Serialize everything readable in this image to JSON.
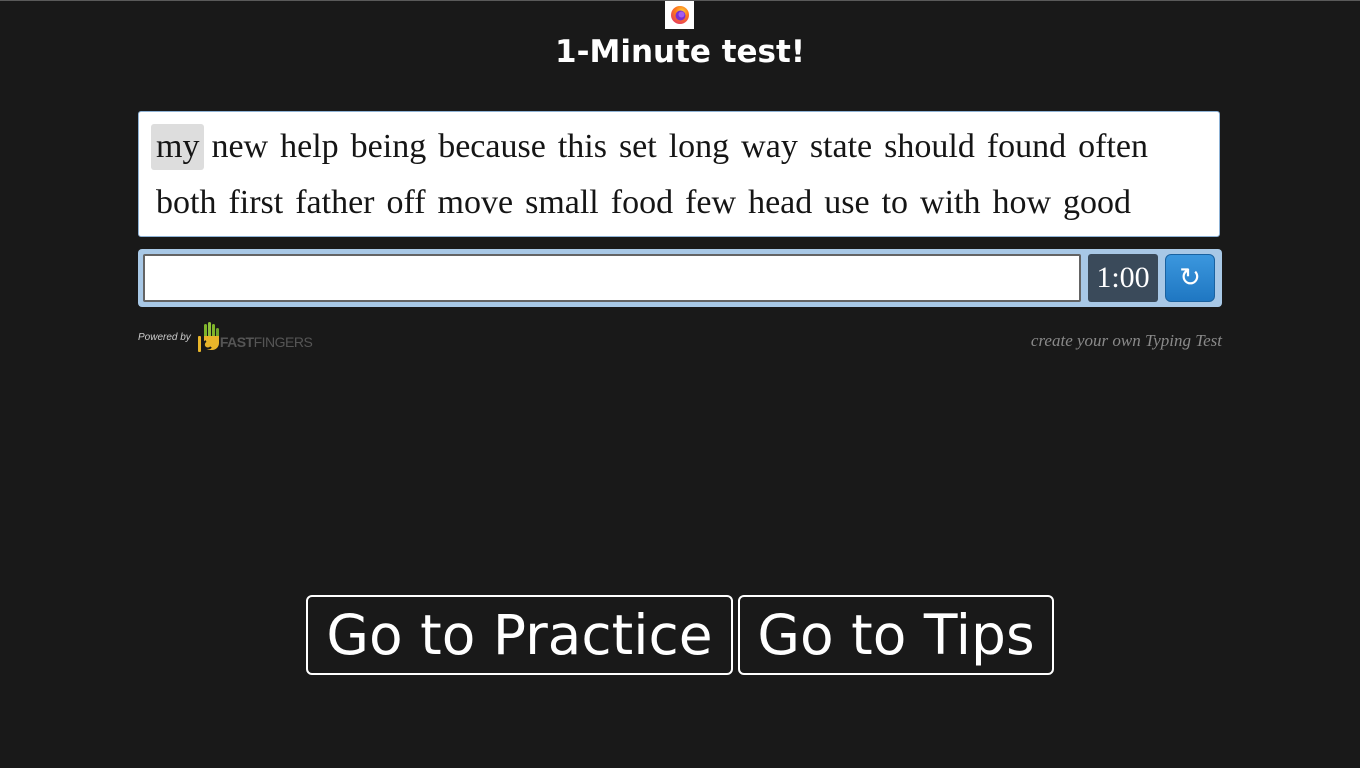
{
  "page": {
    "title": "1-Minute test!"
  },
  "words": [
    "my",
    "new",
    "help",
    "being",
    "because",
    "this",
    "set",
    "long",
    "way",
    "state",
    "should",
    "found",
    "often",
    "both",
    "first",
    "father",
    "off",
    "move",
    "small",
    "food",
    "few",
    "head",
    "use",
    "to",
    "with",
    "how",
    "good"
  ],
  "typing": {
    "input_value": "",
    "placeholder": "",
    "timer": "1:00",
    "reload_symbol": "↻"
  },
  "footer": {
    "powered_by": "Powered by",
    "brand_fast": "FAST",
    "brand_fingers": "FINGERS",
    "create_link": "create your own Typing Test"
  },
  "nav": {
    "practice_label": "Go to Practice",
    "tips_label": "Go to Tips"
  },
  "colors": {
    "background": "#191919",
    "accent_blue": "#2a86d0",
    "highlight": "#dddddd"
  }
}
